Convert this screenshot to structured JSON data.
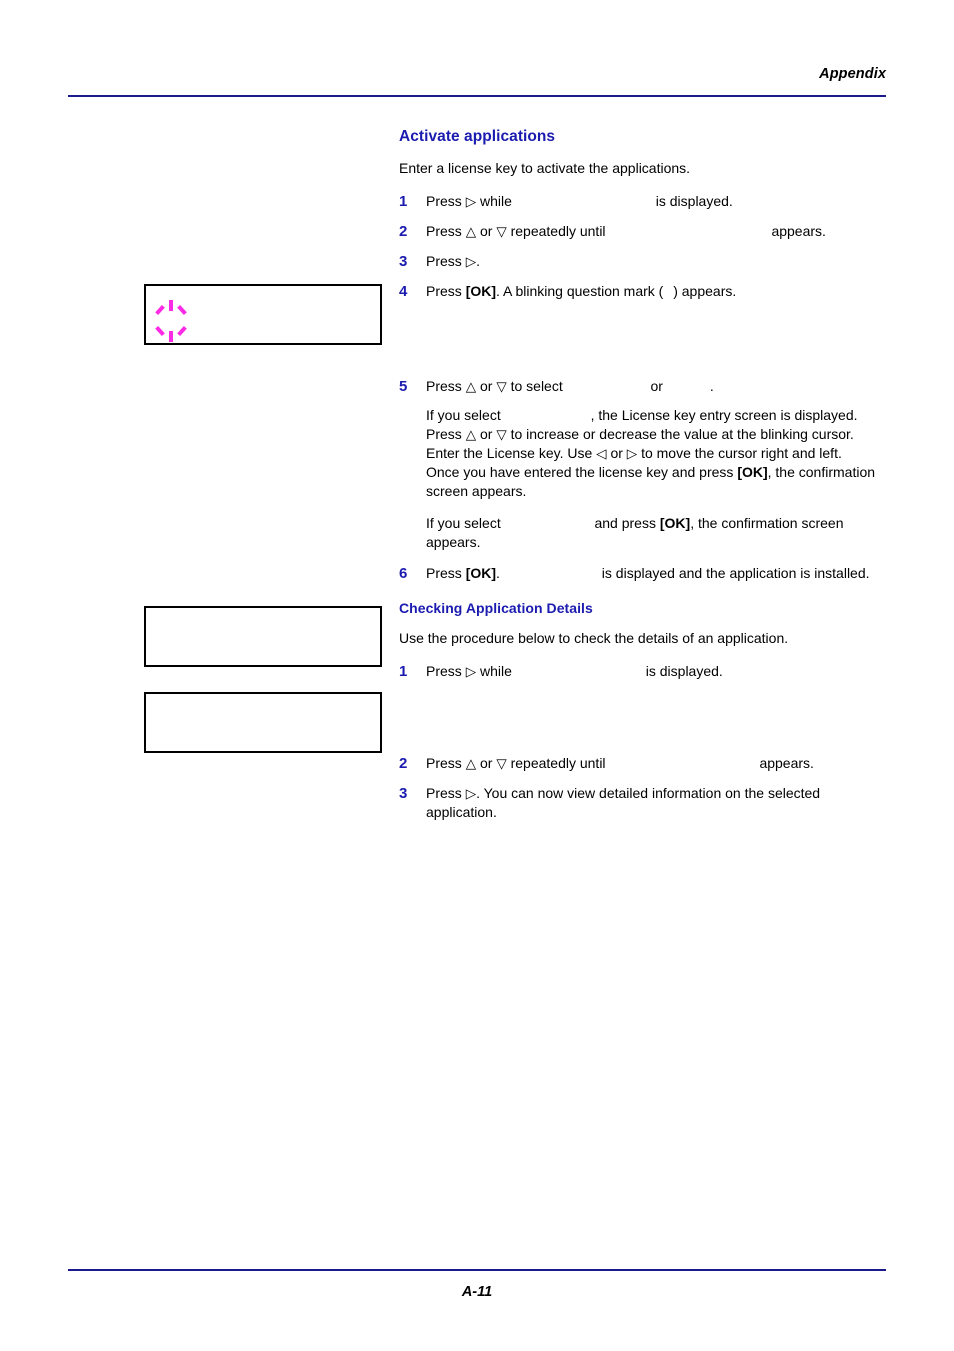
{
  "page": {
    "header_title": "Appendix",
    "footer_page_number": "A-11",
    "rule_color": "#1a1a8c",
    "heading_color": "#1b1bb0",
    "blink_marker_color": "#ff2ae6"
  },
  "section": {
    "heading": "Activate applications",
    "intro": "Enter a license key to activate the applications.",
    "steps": [
      {
        "number": "1",
        "before": "Press ",
        "glyph": "▷",
        "middle": " while ",
        "after": "is displayed."
      },
      {
        "number": "2",
        "before": "Press ",
        "glyph_up": "△",
        "or": " or ",
        "glyph_down": "▽",
        "middle": " repeatedly until ",
        "after": "appears."
      },
      {
        "number": "3",
        "before": "Press ",
        "glyph": "▷",
        "after": "."
      },
      {
        "number": "4",
        "before": "Press ",
        "kbd": "[OK]",
        "middle": ". A blinking question mark ( ",
        "after": ") appears."
      },
      {
        "number": "5",
        "before": "Press ",
        "glyph_up": "△",
        "or": " or ",
        "glyph_down": "▽",
        "middle": " to select ",
        "conj": " or ",
        "after": "."
      },
      {
        "number": "6",
        "before": "Press ",
        "kbd": "[OK]",
        "middle": ". ",
        "after": "is displayed and the application is installed."
      }
    ],
    "step5_paragraph_1": {
      "l1_before": "If you select ",
      "l1_after": ", the License key entry screen is displayed.",
      "l2_before": "Press ",
      "l2_glyph_up": "△",
      "l2_or": " or ",
      "l2_glyph_down": "▽",
      "l2_after": " to increase or decrease the value at the blinking cursor.",
      "l3_before": "Enter the License key. Use ",
      "l3_glyph_left": "◁",
      "l3_or": " or ",
      "l3_glyph_right": "▷",
      "l3_after": " to move the cursor right and left.",
      "l4_before": "Once you have entered the license key and press ",
      "l4_kbd": "[OK]",
      "l4_after": ", the confirmation screen appears."
    },
    "step5_paragraph_2": {
      "before": "If you select ",
      "middle": " and press ",
      "kbd": "[OK]",
      "after": ", the confirmation screen appears."
    }
  },
  "subsection": {
    "heading": "Checking Application Details",
    "intro": "Use the procedure below to check the details of an application.",
    "steps": [
      {
        "number": "1",
        "before": "Press ",
        "glyph": "▷",
        "middle": " while ",
        "after": "is displayed."
      },
      {
        "number": "2",
        "before": "Press ",
        "glyph_up": "△",
        "or": " or ",
        "glyph_down": "▽",
        "middle": " repeatedly until ",
        "after": "appears."
      },
      {
        "number": "3",
        "before": "Press ",
        "glyph": "▷",
        "after": ". You can now view detailed information on the selected application."
      }
    ]
  },
  "illustrations": [
    {
      "name": "blinking-question-mark-display",
      "has_blink_marker": true
    },
    {
      "name": "application-menu-display-1",
      "has_blink_marker": false
    },
    {
      "name": "application-menu-display-2",
      "has_blink_marker": false
    }
  ]
}
